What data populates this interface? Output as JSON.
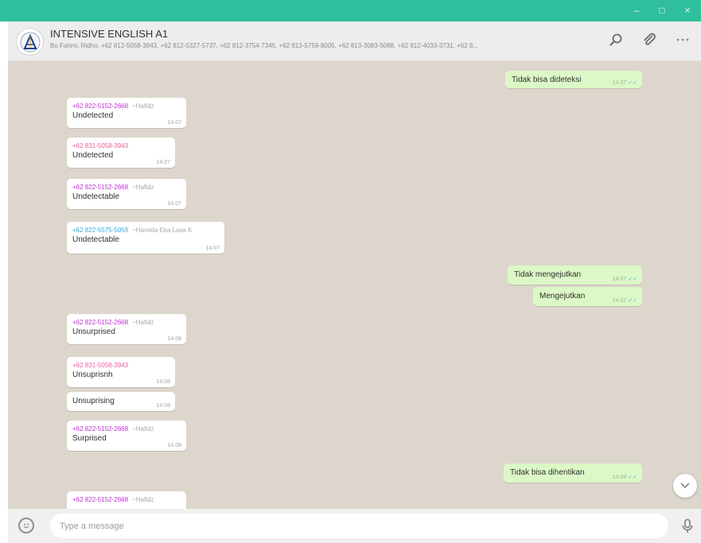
{
  "window": {
    "controls": {
      "minimize": "–",
      "maximize": "□",
      "close": "×"
    }
  },
  "header": {
    "group_name": "INTENSIVE ENGLISH A1",
    "participants": "Bu Fahmi, Ridho, +62 812-5058-3943, +62 812-5327-5737, +62 812-3754-7345, +62 813-5759-8005, +62 813-3083-5088, +62 812-4033-3731, +62 8...",
    "icons": [
      "search-icon",
      "paperclip-icon",
      "menu-icon"
    ]
  },
  "messages": [
    {
      "kind": "out",
      "text": "Tidak bisa dideteksi",
      "time": "14.07"
    },
    {
      "kind": "in",
      "sender": "+62 822-5152-2668",
      "alias": "~Hafidz",
      "sender_color": "#c02fd6",
      "text": "Undetected",
      "time": "14.07"
    },
    {
      "kind": "in",
      "sender": "+62 831-5058-3943",
      "alias": "",
      "sender_color": "#ee5a9b",
      "text": "Undetected",
      "time": "14.07"
    },
    {
      "kind": "in",
      "sender": "+62 822-5152-2668",
      "alias": "~Hafidz",
      "sender_color": "#c02fd6",
      "text": "Undetectable",
      "time": "14.07"
    },
    {
      "kind": "in",
      "sender": "+62 822-5575-5059",
      "alias": "~Hamida Eka Lasa K",
      "sender_color": "#35a7de",
      "text": "Undetectable",
      "time": "14.07"
    },
    {
      "kind": "out",
      "text": "Tidak mengejutkan",
      "time": "14.07"
    },
    {
      "kind": "out",
      "text": "Mengejutkan",
      "time": "14.07"
    },
    {
      "kind": "in",
      "sender": "+62 822-5152-2668",
      "alias": "~Hafidz",
      "sender_color": "#c02fd6",
      "text": "Unsurprised",
      "time": "14.08"
    },
    {
      "kind": "in",
      "sender": "+62 831-5058-3943",
      "alias": "",
      "sender_color": "#ee5a9b",
      "text": "Unsuprisnh",
      "time": "14.08"
    },
    {
      "kind": "in",
      "sender": "",
      "alias": "",
      "sender_color": "",
      "text": "Unsuprising",
      "time": "14.08"
    },
    {
      "kind": "in",
      "sender": "+62 822-5152-2668",
      "alias": "~Hafidz",
      "sender_color": "#c02fd6",
      "text": "Surprised",
      "time": "14.08"
    },
    {
      "kind": "out",
      "text": "Tidak bisa dihentikan",
      "time": "14.08"
    },
    {
      "kind": "in",
      "sender": "+62 822-5152-2668",
      "alias": "~Hafidz",
      "sender_color": "#c02fd6",
      "text": "",
      "time": ""
    }
  ],
  "composer": {
    "placeholder": "Type a message",
    "icons": [
      "emoji-icon",
      "microphone-icon"
    ]
  },
  "colors": {
    "titlebar": "#2fbf9c",
    "chat_background": "#ddd6cc",
    "outgoing_bubble": "#dcf8c6",
    "incoming_bubble": "#ffffff",
    "read_ticks": "#4fb6ec"
  }
}
